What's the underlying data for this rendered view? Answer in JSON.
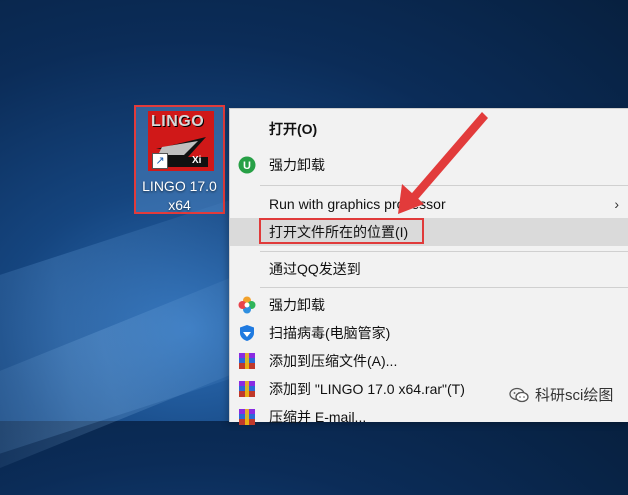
{
  "desktop_icon": {
    "logo_text": "LINGO",
    "label_line1": "LINGO 17.0",
    "label_line2": "x64"
  },
  "context_menu": {
    "items": [
      {
        "label": "打开(O)",
        "icon": "none",
        "bold": true
      },
      {
        "label": "强力卸载",
        "icon": "uninstall-green-icon"
      },
      {
        "label": "Run with graphics processor",
        "icon": "none",
        "submenu": true
      },
      {
        "label": "打开文件所在的位置(I)",
        "icon": "none",
        "highlighted": true
      },
      {
        "label": "通过QQ发送到",
        "icon": "none"
      },
      {
        "label": "强力卸载",
        "icon": "flower-icon"
      },
      {
        "label": "扫描病毒(电脑管家)",
        "icon": "shield-icon"
      },
      {
        "label": "添加到压缩文件(A)...",
        "icon": "winrar-icon"
      },
      {
        "label": "添加到 \"LINGO 17.0 x64.rar\"(T)",
        "icon": "winrar-icon"
      },
      {
        "label": "压缩并 E-mail...",
        "icon": "winrar-icon"
      }
    ],
    "submenu_chevron": "›"
  },
  "annotation": {
    "arrow_color": "#e23b3b",
    "box_color": "#e03a3a"
  },
  "watermark": {
    "text": "科研sci绘图",
    "icon": "wechat-icon"
  }
}
